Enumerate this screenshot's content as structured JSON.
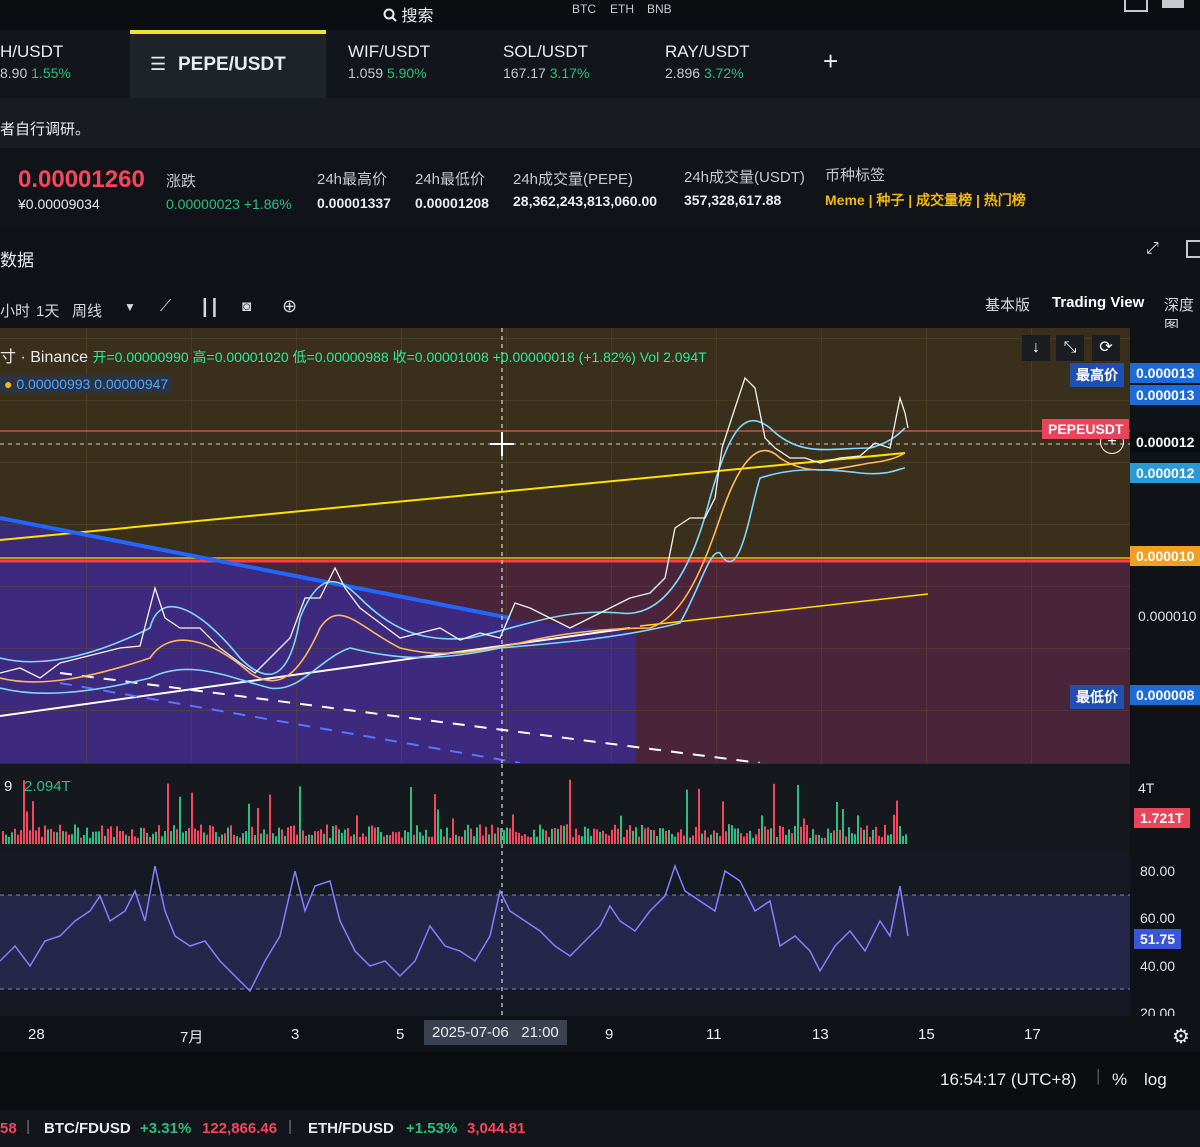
{
  "top": {
    "search": "搜索",
    "coins": [
      "BTC",
      "ETH",
      "BNB"
    ]
  },
  "tabs": [
    {
      "pair": "H/USDT",
      "price": "8.90",
      "change": "1.55%"
    },
    {
      "pair": "PEPE/USDT"
    },
    {
      "pair": "WIF/USDT",
      "price": "1.059",
      "change": "5.90%"
    },
    {
      "pair": "SOL/USDT",
      "price": "167.17",
      "change": "3.17%"
    },
    {
      "pair": "RAY/USDT",
      "price": "2.896",
      "change": "3.72%"
    }
  ],
  "add_tab": "+",
  "notice": "者自行调研。",
  "stats": {
    "price": "0.00001260",
    "price_cny": "¥0.00009034",
    "change_label": "涨跌",
    "change_value": "0.00000023 +1.86%",
    "high_label": "24h最高价",
    "high_value": "0.00001337",
    "low_label": "24h最低价",
    "low_value": "0.00001208",
    "vol_pepe_label": "24h成交量(PEPE)",
    "vol_pepe_value": "28,362,243,813,060.00",
    "vol_usdt_label": "24h成交量(USDT)",
    "vol_usdt_value": "357,328,617.88",
    "tags_label": "币种标签",
    "tags": [
      "Meme",
      "种子",
      "成交量榜",
      "热门榜"
    ]
  },
  "section_title": "数据",
  "toolbar": {
    "intervals": [
      "小时",
      "1天",
      "周线"
    ],
    "views": [
      "基本版",
      "Trading View",
      "深度图"
    ]
  },
  "legend": {
    "symbol": "寸 · Binance",
    "ohlc": "开=0.00000990  高=0.00001020  低=0.00000988  收=0.00001008  +0.00000018 (+1.82%)  Vol 2.094T",
    "bb": [
      "0.00000993",
      "0.00000947"
    ]
  },
  "price_axis": {
    "high_tag": "最高价",
    "high_value": "0.000013",
    "ticks": [
      "0.000013",
      "0.000012",
      "0.000012",
      "0.000010",
      "0.000010",
      "0.000008"
    ],
    "symbol_tag": "PEPEUSDT",
    "low_tag": "最低价",
    "low_value": "0.000008"
  },
  "volume": {
    "label": "9",
    "value": "2.094T",
    "axis": "4T",
    "current": "1.721T"
  },
  "rsi": {
    "ticks": [
      "80.00",
      "60.00",
      "40.00",
      "20.00"
    ],
    "current": "51.75"
  },
  "x_axis": {
    "labels": [
      "28",
      "7月",
      "3",
      "5",
      "9",
      "11",
      "13",
      "15",
      "17"
    ],
    "crosshair": "2025-07-06   21:00"
  },
  "status": {
    "time": "16:54:17 (UTC+8)",
    "percent": "%",
    "log": "log"
  },
  "ticker": [
    {
      "num": "58"
    },
    {
      "pair": "BTC/FDUSD",
      "change": "+3.31%",
      "price": "122,866.46"
    },
    {
      "pair": "ETH/FDUSD",
      "change": "+1.53%",
      "price": "3,044.81"
    }
  ],
  "colors": {
    "up": "#2ebd85",
    "down": "#f6465d",
    "accent": "#f0e230",
    "tag_blue": "#1f6bd6"
  }
}
